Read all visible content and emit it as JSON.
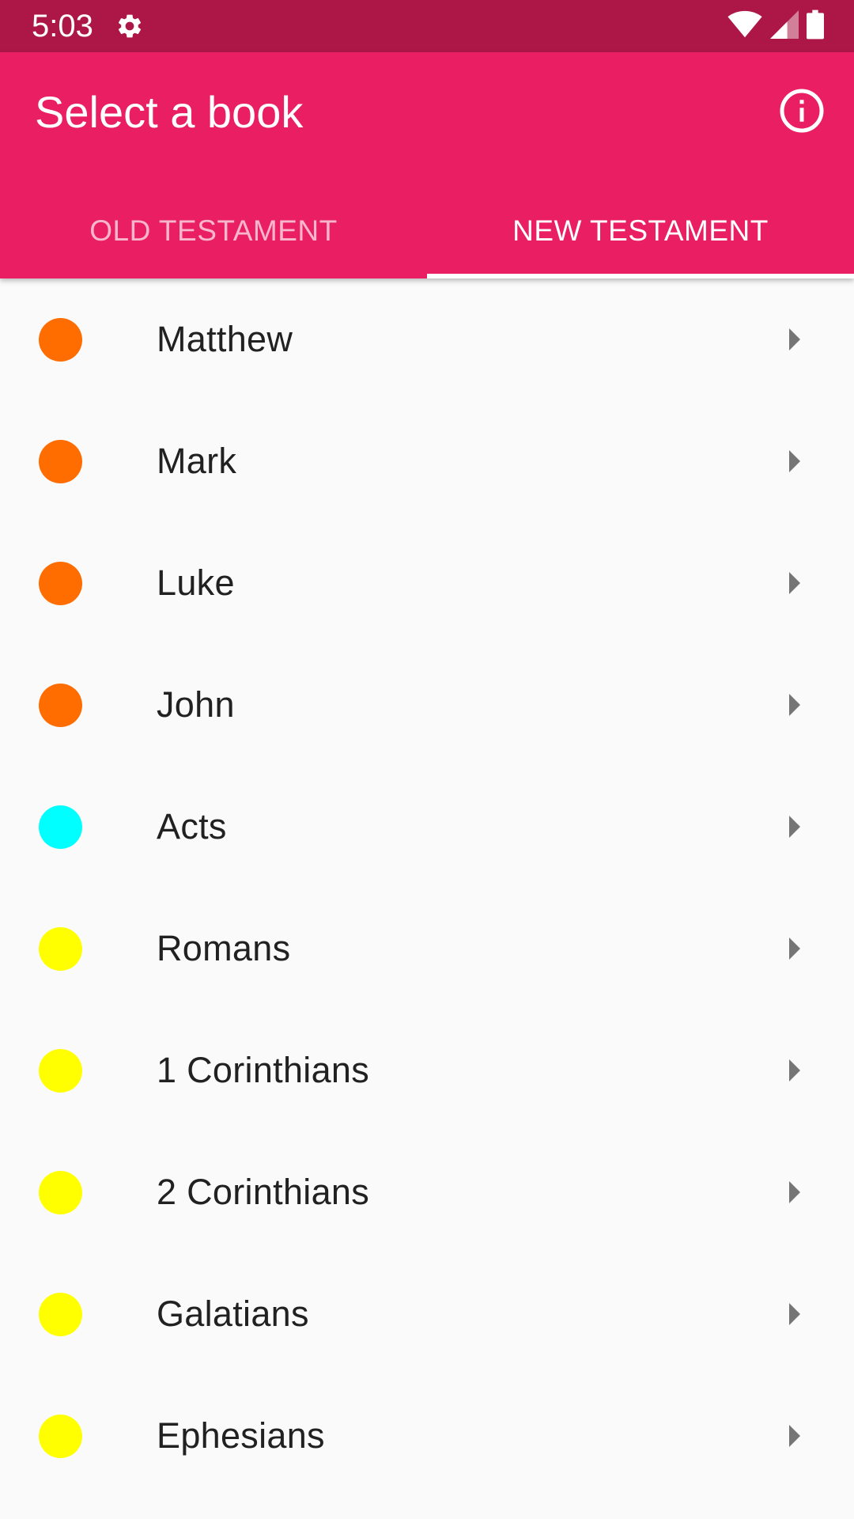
{
  "status_bar": {
    "time": "5:03",
    "icons": [
      "settings-icon",
      "wifi-icon",
      "signal-icon",
      "battery-icon"
    ]
  },
  "app_bar": {
    "title": "Select a book",
    "info_icon": "info-icon",
    "color": "#e91e63",
    "status_color": "#ad1747"
  },
  "tabs": [
    {
      "label": "OLD TESTAMENT",
      "active": false
    },
    {
      "label": "NEW TESTAMENT",
      "active": true
    }
  ],
  "books": [
    {
      "name": "Matthew",
      "color": "#ff6d00"
    },
    {
      "name": "Mark",
      "color": "#ff6d00"
    },
    {
      "name": "Luke",
      "color": "#ff6d00"
    },
    {
      "name": "John",
      "color": "#ff6d00"
    },
    {
      "name": "Acts",
      "color": "#00ffff"
    },
    {
      "name": "Romans",
      "color": "#ffff00"
    },
    {
      "name": "1 Corinthians",
      "color": "#ffff00"
    },
    {
      "name": "2 Corinthians",
      "color": "#ffff00"
    },
    {
      "name": "Galatians",
      "color": "#ffff00"
    },
    {
      "name": "Ephesians",
      "color": "#ffff00"
    }
  ]
}
